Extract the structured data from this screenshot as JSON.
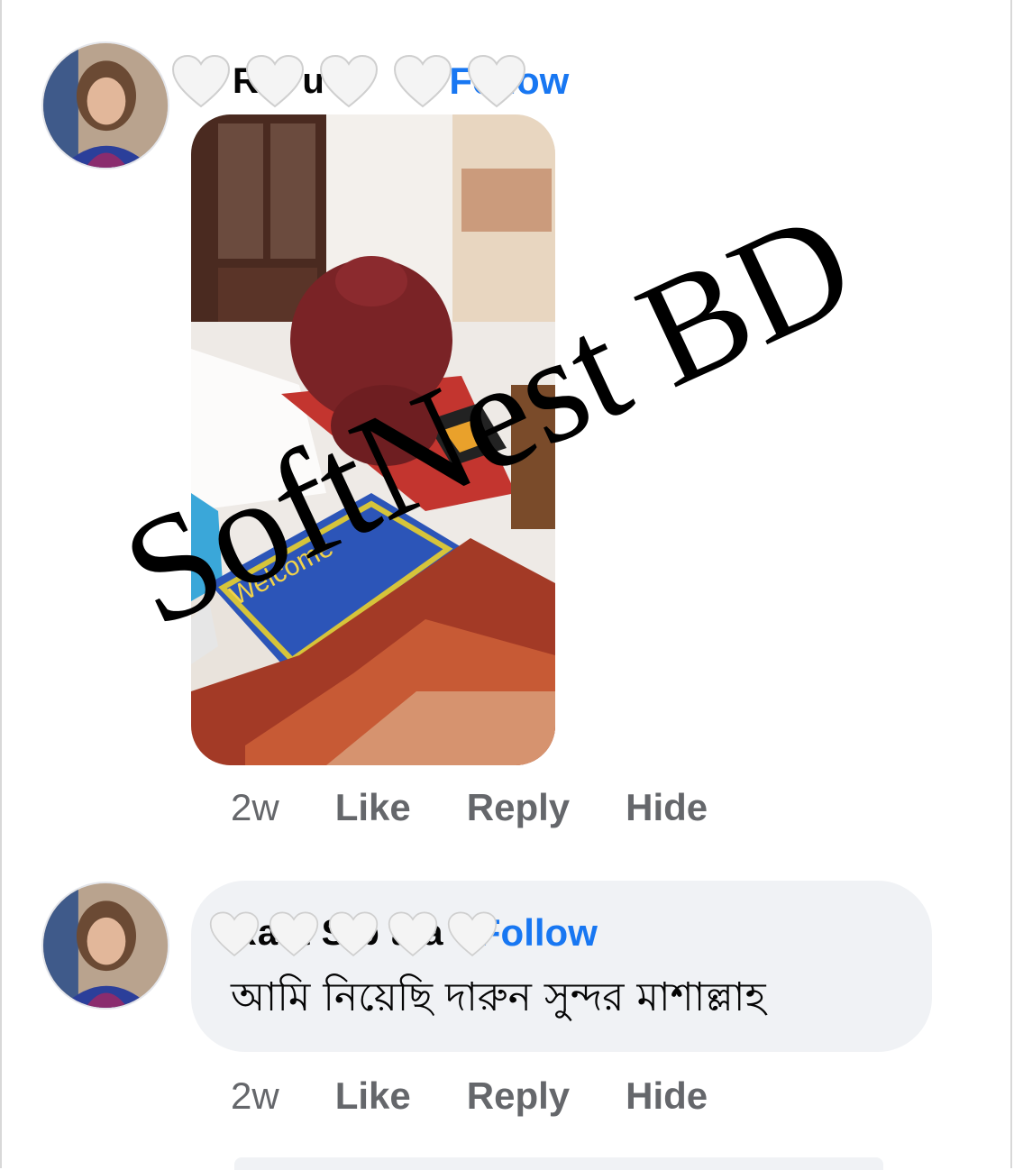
{
  "comment1": {
    "author_name": "R  a   u   n",
    "follow_label": "Follow",
    "timestamp": "2w",
    "actions": [
      "Like",
      "Reply",
      "Hide"
    ],
    "photo_text": "Welcome"
  },
  "comment2": {
    "author_name": "Ra  a  S  b  a  a",
    "separator": "·",
    "follow_label": "Follow",
    "text": "আমি নিয়েছি দারুন সুন্দর মাশাল্লাহ",
    "timestamp": "2w",
    "actions": [
      "Like",
      "Reply",
      "Hide"
    ]
  },
  "watermark": "SoftNest BD",
  "colors": {
    "link": "#1877f2",
    "secondary": "#65676b",
    "bubble": "#f0f2f5"
  }
}
